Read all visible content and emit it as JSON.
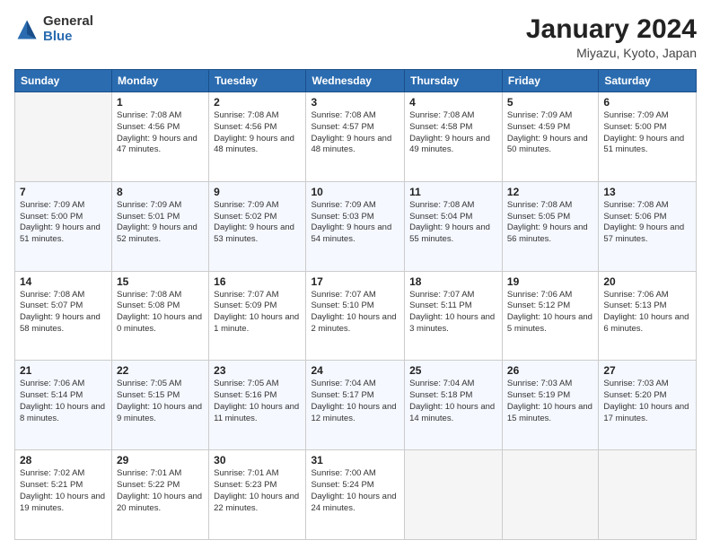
{
  "logo": {
    "general": "General",
    "blue": "Blue"
  },
  "title": "January 2024",
  "subtitle": "Miyazu, Kyoto, Japan",
  "headers": [
    "Sunday",
    "Monday",
    "Tuesday",
    "Wednesday",
    "Thursday",
    "Friday",
    "Saturday"
  ],
  "weeks": [
    [
      {
        "num": "",
        "empty": true
      },
      {
        "num": "1",
        "sunrise": "7:08 AM",
        "sunset": "4:56 PM",
        "daylight": "9 hours and 47 minutes."
      },
      {
        "num": "2",
        "sunrise": "7:08 AM",
        "sunset": "4:56 PM",
        "daylight": "9 hours and 48 minutes."
      },
      {
        "num": "3",
        "sunrise": "7:08 AM",
        "sunset": "4:57 PM",
        "daylight": "9 hours and 48 minutes."
      },
      {
        "num": "4",
        "sunrise": "7:08 AM",
        "sunset": "4:58 PM",
        "daylight": "9 hours and 49 minutes."
      },
      {
        "num": "5",
        "sunrise": "7:09 AM",
        "sunset": "4:59 PM",
        "daylight": "9 hours and 50 minutes."
      },
      {
        "num": "6",
        "sunrise": "7:09 AM",
        "sunset": "5:00 PM",
        "daylight": "9 hours and 51 minutes."
      }
    ],
    [
      {
        "num": "7",
        "sunrise": "7:09 AM",
        "sunset": "5:00 PM",
        "daylight": "9 hours and 51 minutes."
      },
      {
        "num": "8",
        "sunrise": "7:09 AM",
        "sunset": "5:01 PM",
        "daylight": "9 hours and 52 minutes."
      },
      {
        "num": "9",
        "sunrise": "7:09 AM",
        "sunset": "5:02 PM",
        "daylight": "9 hours and 53 minutes."
      },
      {
        "num": "10",
        "sunrise": "7:09 AM",
        "sunset": "5:03 PM",
        "daylight": "9 hours and 54 minutes."
      },
      {
        "num": "11",
        "sunrise": "7:08 AM",
        "sunset": "5:04 PM",
        "daylight": "9 hours and 55 minutes."
      },
      {
        "num": "12",
        "sunrise": "7:08 AM",
        "sunset": "5:05 PM",
        "daylight": "9 hours and 56 minutes."
      },
      {
        "num": "13",
        "sunrise": "7:08 AM",
        "sunset": "5:06 PM",
        "daylight": "9 hours and 57 minutes."
      }
    ],
    [
      {
        "num": "14",
        "sunrise": "7:08 AM",
        "sunset": "5:07 PM",
        "daylight": "9 hours and 58 minutes."
      },
      {
        "num": "15",
        "sunrise": "7:08 AM",
        "sunset": "5:08 PM",
        "daylight": "10 hours and 0 minutes."
      },
      {
        "num": "16",
        "sunrise": "7:07 AM",
        "sunset": "5:09 PM",
        "daylight": "10 hours and 1 minute."
      },
      {
        "num": "17",
        "sunrise": "7:07 AM",
        "sunset": "5:10 PM",
        "daylight": "10 hours and 2 minutes."
      },
      {
        "num": "18",
        "sunrise": "7:07 AM",
        "sunset": "5:11 PM",
        "daylight": "10 hours and 3 minutes."
      },
      {
        "num": "19",
        "sunrise": "7:06 AM",
        "sunset": "5:12 PM",
        "daylight": "10 hours and 5 minutes."
      },
      {
        "num": "20",
        "sunrise": "7:06 AM",
        "sunset": "5:13 PM",
        "daylight": "10 hours and 6 minutes."
      }
    ],
    [
      {
        "num": "21",
        "sunrise": "7:06 AM",
        "sunset": "5:14 PM",
        "daylight": "10 hours and 8 minutes."
      },
      {
        "num": "22",
        "sunrise": "7:05 AM",
        "sunset": "5:15 PM",
        "daylight": "10 hours and 9 minutes."
      },
      {
        "num": "23",
        "sunrise": "7:05 AM",
        "sunset": "5:16 PM",
        "daylight": "10 hours and 11 minutes."
      },
      {
        "num": "24",
        "sunrise": "7:04 AM",
        "sunset": "5:17 PM",
        "daylight": "10 hours and 12 minutes."
      },
      {
        "num": "25",
        "sunrise": "7:04 AM",
        "sunset": "5:18 PM",
        "daylight": "10 hours and 14 minutes."
      },
      {
        "num": "26",
        "sunrise": "7:03 AM",
        "sunset": "5:19 PM",
        "daylight": "10 hours and 15 minutes."
      },
      {
        "num": "27",
        "sunrise": "7:03 AM",
        "sunset": "5:20 PM",
        "daylight": "10 hours and 17 minutes."
      }
    ],
    [
      {
        "num": "28",
        "sunrise": "7:02 AM",
        "sunset": "5:21 PM",
        "daylight": "10 hours and 19 minutes."
      },
      {
        "num": "29",
        "sunrise": "7:01 AM",
        "sunset": "5:22 PM",
        "daylight": "10 hours and 20 minutes."
      },
      {
        "num": "30",
        "sunrise": "7:01 AM",
        "sunset": "5:23 PM",
        "daylight": "10 hours and 22 minutes."
      },
      {
        "num": "31",
        "sunrise": "7:00 AM",
        "sunset": "5:24 PM",
        "daylight": "10 hours and 24 minutes."
      },
      {
        "num": "",
        "empty": true
      },
      {
        "num": "",
        "empty": true
      },
      {
        "num": "",
        "empty": true
      }
    ]
  ],
  "labels": {
    "sunrise": "Sunrise:",
    "sunset": "Sunset:",
    "daylight": "Daylight:"
  }
}
